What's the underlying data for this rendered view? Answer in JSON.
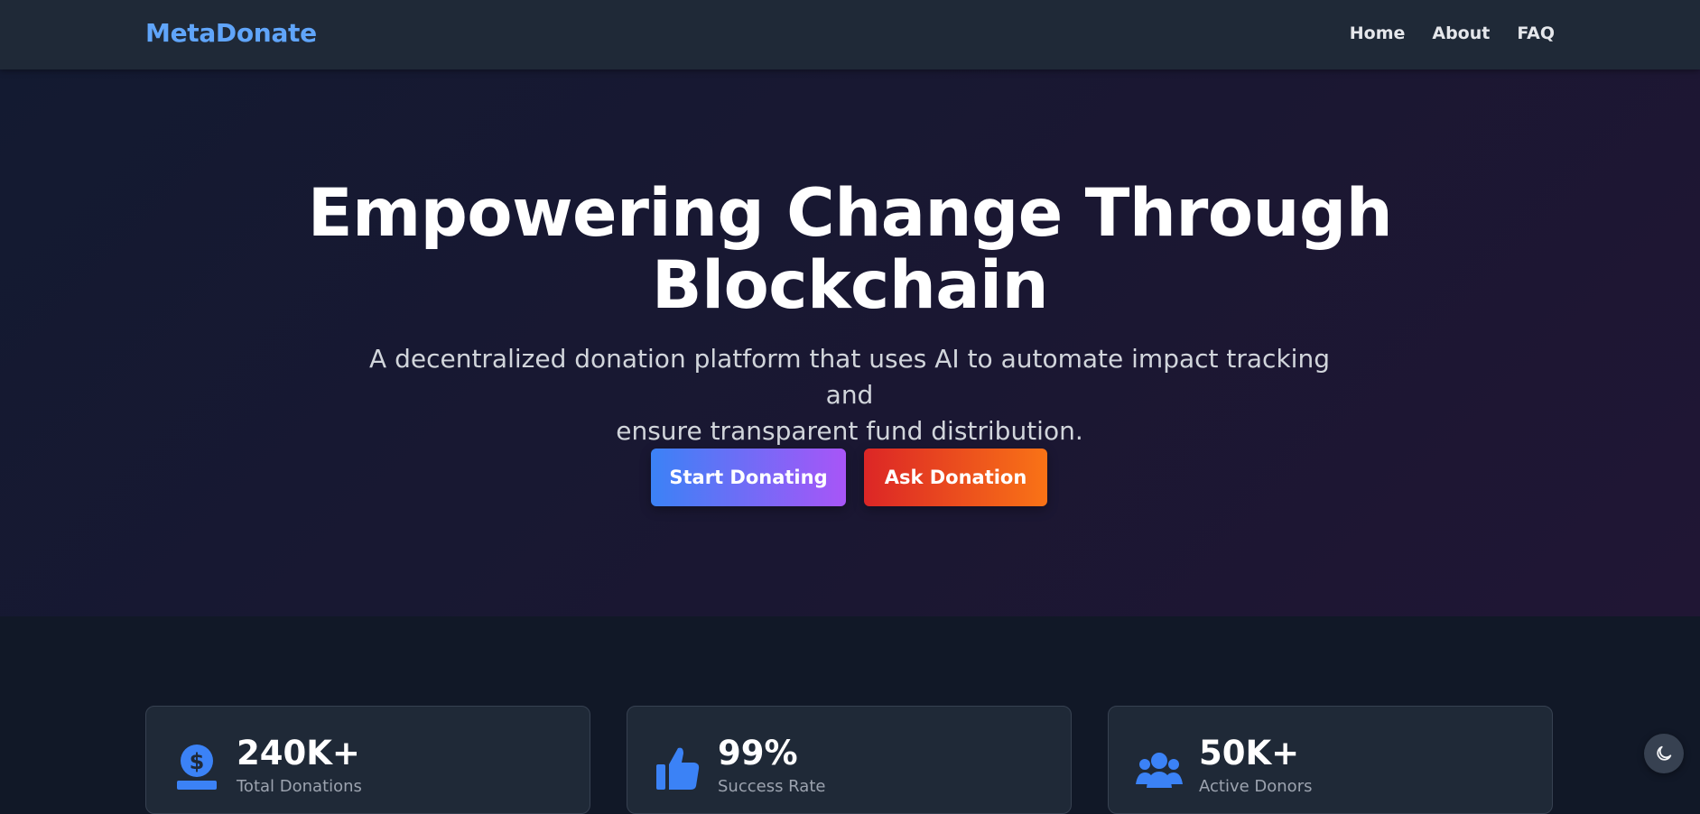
{
  "nav": {
    "brand": "MetaDonate",
    "links": [
      "Home",
      "About",
      "FAQ"
    ]
  },
  "hero": {
    "title_line1": "Empowering Change Through",
    "title_line2": "Blockchain",
    "subtitle_line1": "A decentralized donation platform that uses AI to automate impact tracking and",
    "subtitle_line2": "ensure transparent fund distribution.",
    "buttons": {
      "start": "Start Donating",
      "ask": "Ask Donation"
    }
  },
  "stats": [
    {
      "value": "240K+",
      "label": "Total Donations",
      "icon": "money-box-icon"
    },
    {
      "value": "99%",
      "label": "Success Rate",
      "icon": "thumbs-up-icon"
    },
    {
      "value": "50K+",
      "label": "Active Donors",
      "icon": "users-icon"
    }
  ],
  "theme_toggle": {
    "icon": "moon-icon"
  },
  "colors": {
    "brand": "#60a5fa",
    "accent_blue": "#3b82f6",
    "accent_purple": "#a855f7",
    "accent_red": "#dc2626",
    "accent_orange": "#f97316",
    "navbar": "#1f2937",
    "page_bg": "#111827"
  }
}
